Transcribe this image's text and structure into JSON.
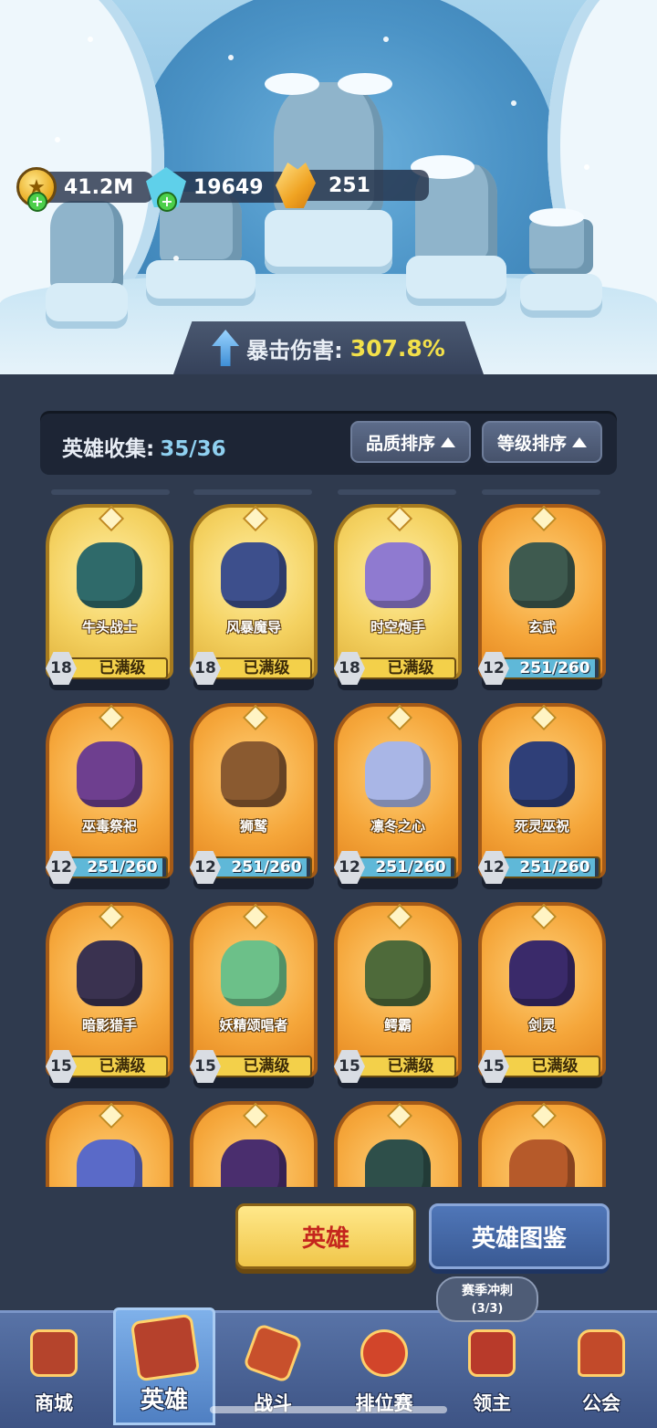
{
  "resources": {
    "gold": {
      "value": "41.2M",
      "icon": "gold-coin-icon"
    },
    "gems": {
      "value": "19649",
      "icon": "blue-gem-icon"
    },
    "crystals": {
      "value": "251",
      "icon": "orange-crystal-icon"
    }
  },
  "crit": {
    "label": "暴击伤害:",
    "value": "307.8%",
    "icon": "up-arrow-icon"
  },
  "collection": {
    "label": "英雄收集:",
    "value": "35/36"
  },
  "sort": {
    "quality": "品质排序",
    "level": "等级排序"
  },
  "heroes": [
    {
      "name": "牛头战士",
      "level": "18",
      "status": "已满级",
      "rarity": "gold",
      "color": "#2f6a6a"
    },
    {
      "name": "风暴魔导",
      "level": "18",
      "status": "已满级",
      "rarity": "gold",
      "color": "#3d4f8c"
    },
    {
      "name": "时空炮手",
      "level": "18",
      "status": "已满级",
      "rarity": "gold",
      "color": "#8f7ad0"
    },
    {
      "name": "玄武",
      "level": "12",
      "status": "251/260",
      "rarity": "orange",
      "color": "#3e5a4f",
      "progress": 0.965
    },
    {
      "name": "巫毒祭祀",
      "level": "12",
      "status": "251/260",
      "rarity": "orange",
      "color": "#6e3f8f",
      "progress": 0.965
    },
    {
      "name": "狮鹫",
      "level": "12",
      "status": "251/260",
      "rarity": "orange",
      "color": "#8a5a30",
      "progress": 0.965
    },
    {
      "name": "凛冬之心",
      "level": "12",
      "status": "251/260",
      "rarity": "orange",
      "color": "#a9b6e6",
      "progress": 0.965
    },
    {
      "name": "死灵巫祝",
      "level": "12",
      "status": "251/260",
      "rarity": "orange",
      "color": "#2f3f78",
      "progress": 0.965
    },
    {
      "name": "暗影猎手",
      "level": "15",
      "status": "已满级",
      "rarity": "orange",
      "color": "#3a3250"
    },
    {
      "name": "妖精颂唱者",
      "level": "15",
      "status": "已满级",
      "rarity": "orange",
      "color": "#6cc089"
    },
    {
      "name": "鳄霸",
      "level": "15",
      "status": "已满级",
      "rarity": "orange",
      "color": "#4e6a3a"
    },
    {
      "name": "剑灵",
      "level": "15",
      "status": "已满级",
      "rarity": "orange",
      "color": "#3a2a6a"
    },
    {
      "name": "",
      "level": "",
      "status": "",
      "rarity": "orange",
      "color": "#5a6ac8"
    },
    {
      "name": "",
      "level": "",
      "status": "",
      "rarity": "orange",
      "color": "#4a2e6e"
    },
    {
      "name": "",
      "level": "",
      "status": "",
      "rarity": "orange",
      "color": "#2e4f4a"
    },
    {
      "name": "",
      "level": "",
      "status": "",
      "rarity": "orange",
      "color": "#b65a2a"
    }
  ],
  "actions": {
    "hero": "英雄",
    "codex": "英雄图鉴"
  },
  "event_bubble": {
    "title": "赛季冲刺",
    "count": "(3/3)"
  },
  "nav": [
    {
      "label": "商城",
      "icon": "shop-icon",
      "color": "#b5442c"
    },
    {
      "label": "英雄",
      "icon": "hero-cards-icon",
      "color": "#b6412c"
    },
    {
      "label": "战斗",
      "icon": "battle-icon",
      "color": "#c8502c"
    },
    {
      "label": "排位赛",
      "icon": "ranked-knot-icon",
      "color": "#d2452a"
    },
    {
      "label": "领主",
      "icon": "lord-banner-icon",
      "color": "#b83a2a"
    },
    {
      "label": "公会",
      "icon": "guild-hall-icon",
      "color": "#c24a2a"
    }
  ]
}
